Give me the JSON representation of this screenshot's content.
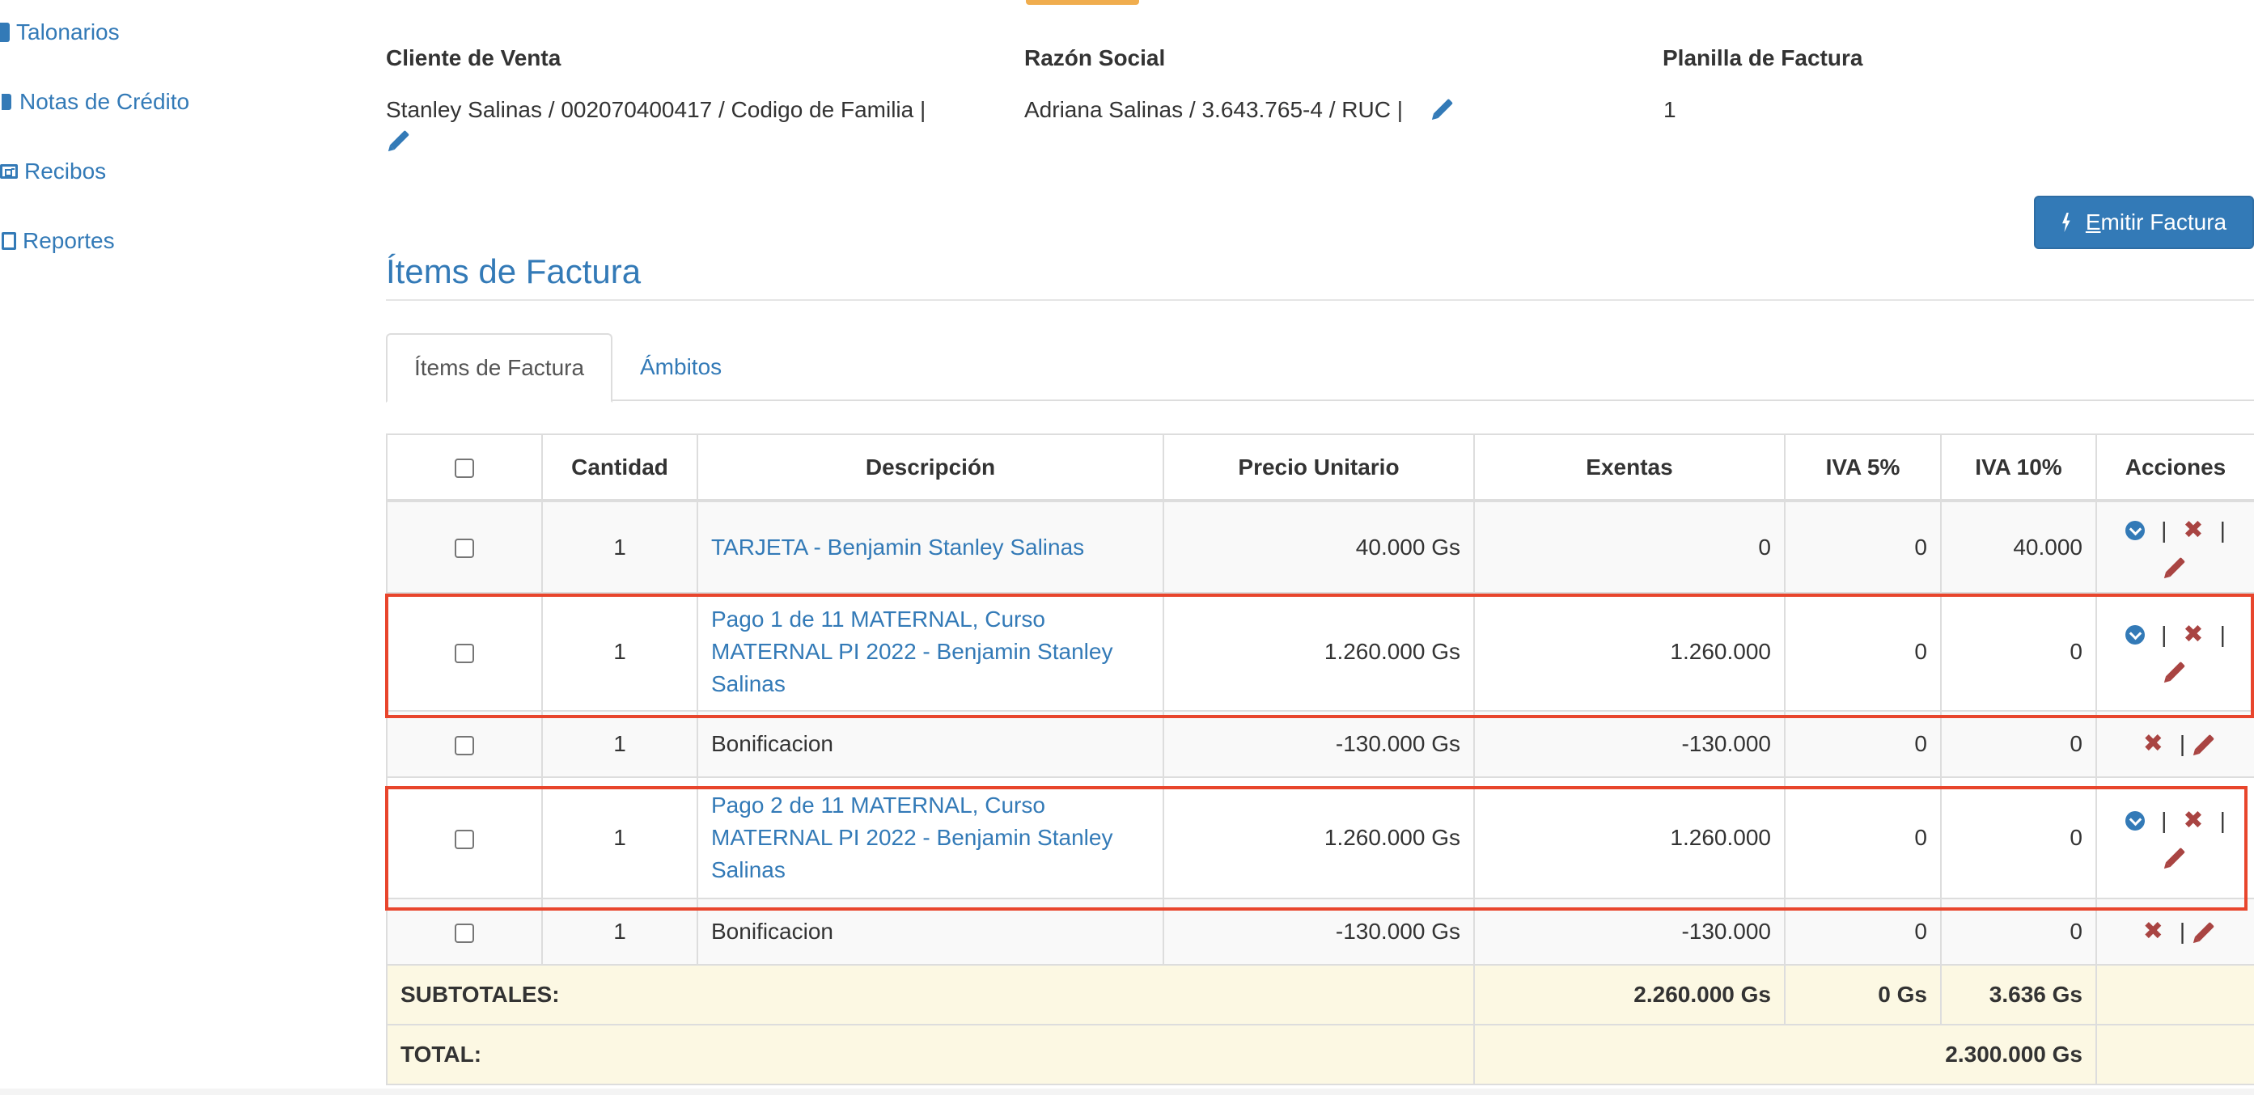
{
  "sidebar": {
    "items": [
      {
        "label": "Talonarios",
        "icon": "book-icon"
      },
      {
        "label": "Notas de Crédito",
        "icon": "bookmark-icon"
      },
      {
        "label": "Recibos",
        "icon": "id-card-icon"
      },
      {
        "label": "Reportes",
        "icon": "document-icon"
      }
    ]
  },
  "fields": {
    "cliente": {
      "label": "Cliente de Venta",
      "value": "Stanley Salinas / 002070400417 / Codigo de Familia  |"
    },
    "razon": {
      "label": "Razón Social",
      "value": "Adriana Salinas / 3.643.765-4 / RUC  |"
    },
    "planilla": {
      "label": "Planilla de Factura",
      "value": "1"
    }
  },
  "actions": {
    "emitir_prefix": "E",
    "emitir_rest": "mitir Factura"
  },
  "section": {
    "title": "Ítems de Factura"
  },
  "tabs": [
    {
      "label": "Ítems de Factura",
      "active": true
    },
    {
      "label": "Ámbitos",
      "active": false
    }
  ],
  "table": {
    "headers": [
      "",
      "Cantidad",
      "Descripción",
      "Precio Unitario",
      "Exentas",
      "IVA 5%",
      "IVA 10%",
      "Acciones"
    ],
    "rows": [
      {
        "cantidad": "1",
        "descripcion": "TARJETA - Benjamin Stanley Salinas",
        "precio": "40.000 Gs",
        "exentas": "0",
        "iva5": "0",
        "iva10": "40.000"
      },
      {
        "cantidad": "1",
        "descripcion": "Pago 1 de 11 MATERNAL, Curso MATERNAL PI 2022 - Benjamin Stanley Salinas",
        "precio": "1.260.000 Gs",
        "exentas": "1.260.000",
        "iva5": "0",
        "iva10": "0"
      },
      {
        "cantidad": "1",
        "descripcion": "Bonificacion",
        "precio": "-130.000 Gs",
        "exentas": "-130.000",
        "iva5": "0",
        "iva10": "0"
      },
      {
        "cantidad": "1",
        "descripcion": "Pago 2 de 11 MATERNAL, Curso MATERNAL PI 2022 - Benjamin Stanley Salinas",
        "precio": "1.260.000 Gs",
        "exentas": "1.260.000",
        "iva5": "0",
        "iva10": "0"
      },
      {
        "cantidad": "1",
        "descripcion": "Bonificacion",
        "precio": "-130.000 Gs",
        "exentas": "-130.000",
        "iva5": "0",
        "iva10": "0"
      }
    ],
    "subtotales": {
      "label": "SUBTOTALES:",
      "exentas": "2.260.000 Gs",
      "iva5": "0 Gs",
      "iva10": "3.636 Gs"
    },
    "total": {
      "label": "TOTAL:",
      "value": "2.300.000 Gs"
    },
    "separator": "|"
  },
  "colors": {
    "link": "#337ab7",
    "danger": "#a94442",
    "highlight": "#e8452c",
    "subtotal_bg": "#fcf8e3"
  }
}
